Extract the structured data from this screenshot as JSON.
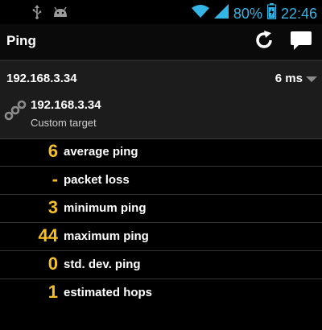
{
  "statusbar": {
    "battery_percent": "80%",
    "time": "22:46",
    "accent_color": "#34b5e5",
    "icons": [
      "usb-icon",
      "android-debug-icon",
      "wifi-icon",
      "signal-icon",
      "battery-icon"
    ]
  },
  "actionbar": {
    "title": "Ping",
    "icons": [
      "refresh-icon",
      "comment-icon"
    ]
  },
  "target": {
    "host": "192.168.3.34",
    "latency": "6 ms",
    "address": "192.168.3.34",
    "subtitle": "Custom target",
    "icon": "link-icon"
  },
  "stats": [
    {
      "value": "6",
      "label": "average ping"
    },
    {
      "value": "-",
      "label": "packet loss"
    },
    {
      "value": "3",
      "label": "minimum ping"
    },
    {
      "value": "44",
      "label": "maximum ping"
    },
    {
      "value": "0",
      "label": "std. dev. ping"
    },
    {
      "value": "1",
      "label": "estimated hops"
    }
  ],
  "colors": {
    "value_color": "#f6bf25",
    "background": "#000000",
    "panel": "#1c1c1c"
  }
}
